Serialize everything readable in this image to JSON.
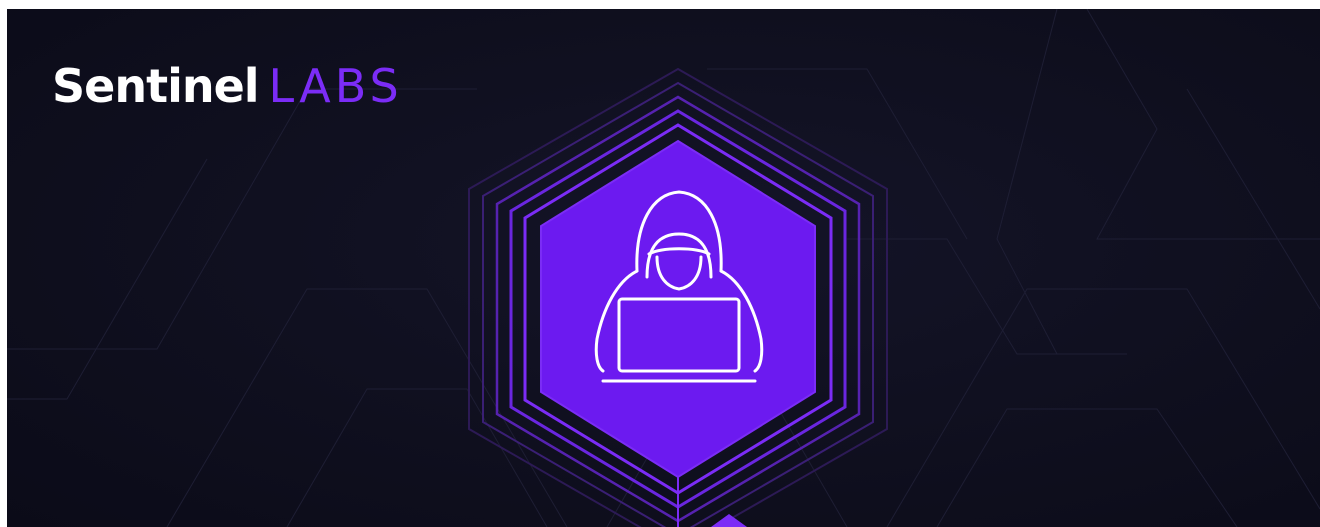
{
  "brand": {
    "name_primary": "Sentinel",
    "name_secondary": "LABS",
    "logo_colors": {
      "primary": "#ffffff",
      "secondary": "#7b2cf6"
    }
  },
  "emblem": {
    "icon": "hooded-hacker-laptop-icon",
    "fill_color": "#6c1af0",
    "ring_color": "#7b2cf6",
    "icon_color": "#ffffff"
  },
  "background": {
    "color": "#0d0d1a",
    "line_color": "#1f1f36"
  }
}
